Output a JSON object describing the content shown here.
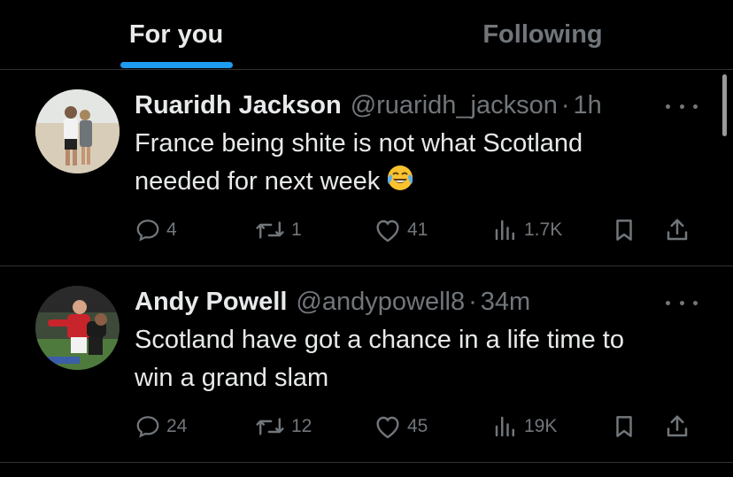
{
  "tabs": [
    {
      "label": "For you",
      "active": true
    },
    {
      "label": "Following",
      "active": false
    }
  ],
  "colors": {
    "accent": "#1d9bf0",
    "text": "#e7e9ea",
    "muted": "#71767b",
    "divider": "#2f3336"
  },
  "posts": [
    {
      "author": "Ruaridh Jackson",
      "handle": "@ruaridh_jackson",
      "separator": "·",
      "time": "1h",
      "text_line1": "France being shite is not what Scotland",
      "text_line2": "needed for next week",
      "emoji": "face-with-tears-of-joy",
      "replies": "4",
      "reposts": "1",
      "likes": "41",
      "views": "1.7K"
    },
    {
      "author": "Andy Powell",
      "handle": "@andypowell8",
      "separator": "·",
      "time": "34m",
      "text_line1": "Scotland have got a chance in a life time to",
      "text_line2": "win a grand slam",
      "replies": "24",
      "reposts": "12",
      "likes": "45",
      "views": "19K"
    }
  ]
}
